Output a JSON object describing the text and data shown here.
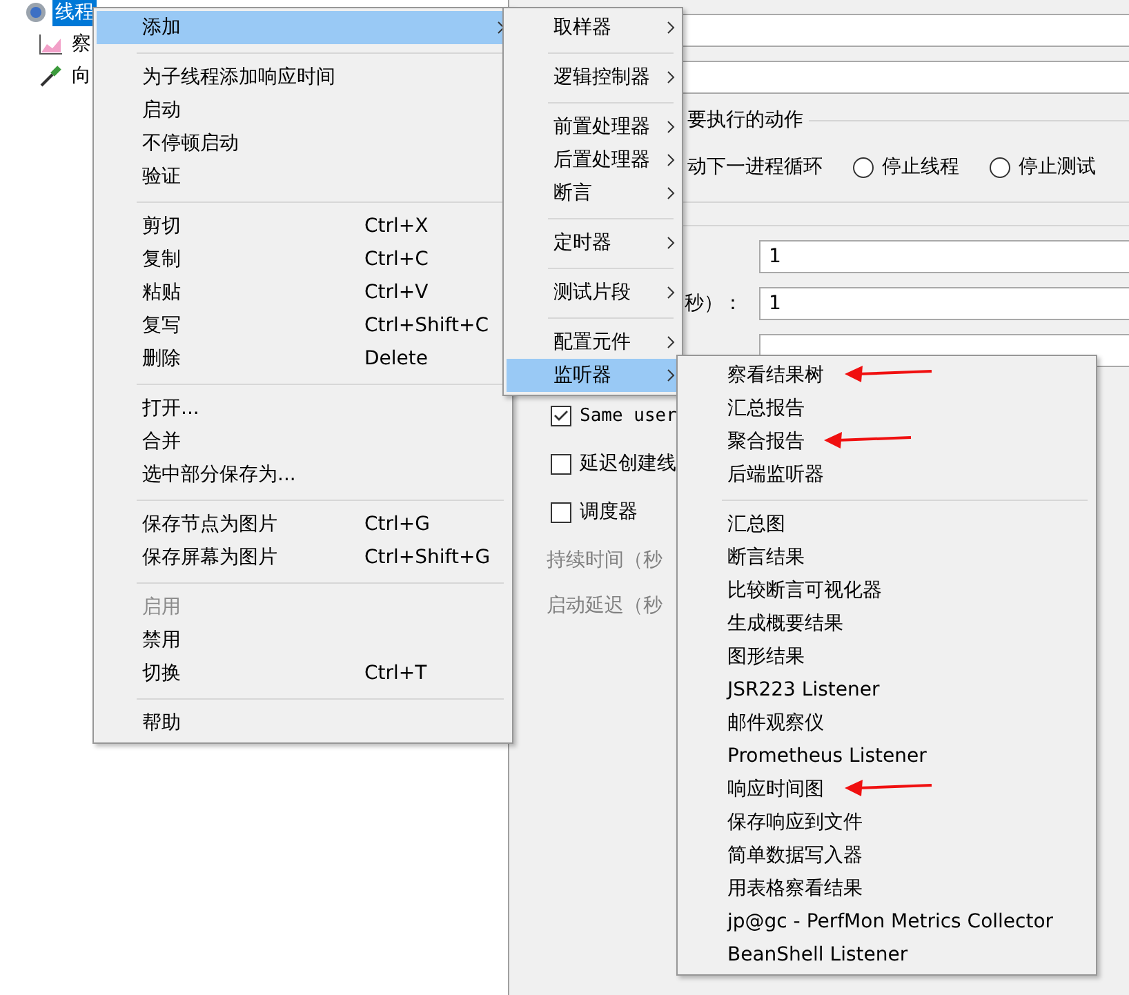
{
  "tree": [
    {
      "label": "线程",
      "kind": "gear",
      "selected": true,
      "children": [
        {
          "label": "察",
          "kind": "chart",
          "selected": false
        },
        {
          "label": "向",
          "kind": "pipette",
          "selected": false
        }
      ]
    }
  ],
  "settings": {
    "action_group_label": "要执行的动作",
    "action_text": "动下一进程循环",
    "actions": [
      {
        "label": "停止线程",
        "selected": false
      },
      {
        "label": "停止测试",
        "selected": false
      }
    ],
    "props": [
      {
        "value": "1"
      },
      {
        "label": "秒）：",
        "value": "1"
      }
    ],
    "checkboxes": [
      {
        "label": "Same user",
        "checked": true,
        "kind": "mono"
      },
      {
        "label": "延迟创建线",
        "checked": false,
        "kind": "plain"
      },
      {
        "label": "调度器",
        "checked": false,
        "kind": "plain"
      }
    ],
    "disabled_labels": [
      "持续时间（秒",
      "启动延迟（秒"
    ]
  },
  "context_menu": [
    [
      {
        "label": "添加",
        "selected": true,
        "disabled": false,
        "has_submenu": true
      }
    ],
    [
      {
        "label": "为子线程添加响应时间",
        "selected": false,
        "disabled": false,
        "has_submenu": false
      },
      {
        "label": "启动",
        "selected": false,
        "disabled": false,
        "has_submenu": false
      },
      {
        "label": "不停顿启动",
        "selected": false,
        "disabled": false,
        "has_submenu": false
      },
      {
        "label": "验证",
        "selected": false,
        "disabled": false,
        "has_submenu": false
      }
    ],
    [
      {
        "label": "剪切",
        "shortcut": "Ctrl+X",
        "selected": false,
        "disabled": false,
        "has_submenu": false
      },
      {
        "label": "复制",
        "shortcut": "Ctrl+C",
        "selected": false,
        "disabled": false,
        "has_submenu": false
      },
      {
        "label": "粘贴",
        "shortcut": "Ctrl+V",
        "selected": false,
        "disabled": false,
        "has_submenu": false
      },
      {
        "label": "复写",
        "shortcut": "Ctrl+Shift+C",
        "selected": false,
        "disabled": false,
        "has_submenu": false
      },
      {
        "label": "删除",
        "shortcut": "Delete",
        "selected": false,
        "disabled": false,
        "has_submenu": false
      }
    ],
    [
      {
        "label": "打开...",
        "selected": false,
        "disabled": false,
        "has_submenu": false
      },
      {
        "label": "合并",
        "selected": false,
        "disabled": false,
        "has_submenu": false
      },
      {
        "label": "选中部分保存为...",
        "selected": false,
        "disabled": false,
        "has_submenu": false
      }
    ],
    [
      {
        "label": "保存节点为图片",
        "shortcut": "Ctrl+G",
        "selected": false,
        "disabled": false,
        "has_submenu": false
      },
      {
        "label": "保存屏幕为图片",
        "shortcut": "Ctrl+Shift+G",
        "selected": false,
        "disabled": false,
        "has_submenu": false
      }
    ],
    [
      {
        "label": "启用",
        "selected": false,
        "disabled": true,
        "has_submenu": false
      },
      {
        "label": "禁用",
        "selected": false,
        "disabled": false,
        "has_submenu": false
      },
      {
        "label": "切换",
        "shortcut": "Ctrl+T",
        "selected": false,
        "disabled": false,
        "has_submenu": false
      }
    ],
    [
      {
        "label": "帮助",
        "selected": false,
        "disabled": false,
        "has_submenu": false
      }
    ]
  ],
  "add_submenu": [
    [
      {
        "label": "取样器",
        "selected": false,
        "has_submenu": true
      }
    ],
    [
      {
        "label": "逻辑控制器",
        "selected": false,
        "has_submenu": true
      }
    ],
    [
      {
        "label": "前置处理器",
        "selected": false,
        "has_submenu": true
      },
      {
        "label": "后置处理器",
        "selected": false,
        "has_submenu": true
      },
      {
        "label": "断言",
        "selected": false,
        "has_submenu": true
      }
    ],
    [
      {
        "label": "定时器",
        "selected": false,
        "has_submenu": true
      }
    ],
    [
      {
        "label": "测试片段",
        "selected": false,
        "has_submenu": true
      }
    ],
    [
      {
        "label": "配置元件",
        "selected": false,
        "has_submenu": true
      },
      {
        "label": "监听器",
        "selected": true,
        "has_submenu": true
      }
    ]
  ],
  "listener_submenu": [
    [
      {
        "label": "察看结果树",
        "selected": false,
        "arrow": true
      },
      {
        "label": "汇总报告",
        "selected": false,
        "arrow": false
      },
      {
        "label": "聚合报告",
        "selected": false,
        "arrow": true
      },
      {
        "label": "后端监听器",
        "selected": false,
        "arrow": false
      }
    ],
    [
      {
        "label": "汇总图",
        "selected": false,
        "arrow": false
      },
      {
        "label": "断言结果",
        "selected": false,
        "arrow": false
      },
      {
        "label": "比较断言可视化器",
        "selected": false,
        "arrow": false
      },
      {
        "label": "生成概要结果",
        "selected": false,
        "arrow": false
      },
      {
        "label": "图形结果",
        "selected": false,
        "arrow": false
      },
      {
        "label": "JSR223 Listener",
        "selected": false,
        "arrow": false
      },
      {
        "label": "邮件观察仪",
        "selected": false,
        "arrow": false
      },
      {
        "label": "Prometheus Listener",
        "selected": false,
        "arrow": false
      },
      {
        "label": "响应时间图",
        "selected": false,
        "arrow": true
      },
      {
        "label": "保存响应到文件",
        "selected": false,
        "arrow": false
      },
      {
        "label": "简单数据写入器",
        "selected": false,
        "arrow": false
      },
      {
        "label": "用表格察看结果",
        "selected": false,
        "arrow": false
      },
      {
        "label": "jp@gc - PerfMon Metrics Collector",
        "selected": false,
        "arrow": false
      },
      {
        "label": "BeanShell Listener",
        "selected": false,
        "arrow": false
      }
    ]
  ]
}
